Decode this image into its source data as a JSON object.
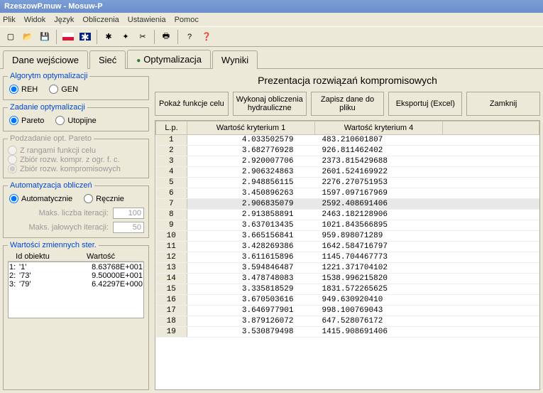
{
  "window": {
    "title": "RzeszowP.muw - Mosuw-P"
  },
  "menu": {
    "items": [
      "Plik",
      "Widok",
      "Język",
      "Obliczenia",
      "Ustawienia",
      "Pomoc"
    ]
  },
  "toolbar_icons": [
    "new",
    "open",
    "save",
    "sep",
    "flag-pl",
    "flag-uk",
    "sep",
    "run-black",
    "printer",
    "run-cut",
    "sep",
    "print",
    "sep",
    "help-q",
    "help-ex"
  ],
  "tabs": {
    "items": [
      "Dane wejściowe",
      "Sieć",
      "Optymalizacja",
      "Wyniki"
    ],
    "active": 2
  },
  "left": {
    "algo": {
      "legend": "Algorytm optymalizacji",
      "opts": [
        "REH",
        "GEN"
      ],
      "sel": 0
    },
    "task": {
      "legend": "Zadanie optymalizacji",
      "opts": [
        "Pareto",
        "Utopijne"
      ],
      "sel": 0
    },
    "subpareto": {
      "legend": "Podzadanie opt. Pareto",
      "opts": [
        "Z rangami funkcji celu",
        "Zbiór rozw. kompr. z ogr. f. c.",
        "Zbiór rozw. kompromisowych"
      ],
      "sel": 2
    },
    "auto": {
      "legend": "Automatyzacja obliczeń",
      "opts": [
        "Automatycznie",
        "Ręcznie"
      ],
      "sel": 0,
      "iter_label": "Maks. liczba iteracji:",
      "iter_val": "100",
      "idle_label": "Maks. jałowych iteracji:",
      "idle_val": "50"
    },
    "ster": {
      "legend": "Wartości zmiennych ster.",
      "cols": [
        "Id obiektu",
        "Wartość"
      ],
      "rows": [
        {
          "n": "1:",
          "id": "'1'",
          "v": "8.63768E+001"
        },
        {
          "n": "2:",
          "id": "'73'",
          "v": "9.50000E+001"
        },
        {
          "n": "3:",
          "id": "'79'",
          "v": "6.42297E+000"
        }
      ]
    }
  },
  "right": {
    "title": "Prezentacja rozwiązań kompromisowych",
    "buttons": [
      "Pokaż funkcje celu",
      "Wykonaj obliczenia hydrauliczne",
      "Zapisz dane do pliku",
      "Eksportuj (Excel)",
      "Zamknij"
    ],
    "cols": [
      "L.p.",
      "Wartość kryterium 1",
      "Wartość kryterium 4"
    ],
    "sel_row": 7,
    "rows": [
      {
        "lp": 1,
        "a": "4.033502579",
        "b": "483.210601807"
      },
      {
        "lp": 2,
        "a": "3.682776928",
        "b": "926.811462402"
      },
      {
        "lp": 3,
        "a": "2.920007706",
        "b": "2373.815429688"
      },
      {
        "lp": 4,
        "a": "2.906324863",
        "b": "2601.524169922"
      },
      {
        "lp": 5,
        "a": "2.948856115",
        "b": "2276.270751953"
      },
      {
        "lp": 6,
        "a": "3.450896263",
        "b": "1597.097167969"
      },
      {
        "lp": 7,
        "a": "2.906835079",
        "b": "2592.408691406"
      },
      {
        "lp": 8,
        "a": "2.913858891",
        "b": "2463.182128906"
      },
      {
        "lp": 9,
        "a": "3.637013435",
        "b": "1021.843566895"
      },
      {
        "lp": 10,
        "a": "3.665156841",
        "b": "959.898071289"
      },
      {
        "lp": 11,
        "a": "3.428269386",
        "b": "1642.584716797"
      },
      {
        "lp": 12,
        "a": "3.611615896",
        "b": "1145.704467773"
      },
      {
        "lp": 13,
        "a": "3.594846487",
        "b": "1221.371704102"
      },
      {
        "lp": 14,
        "a": "3.478748083",
        "b": "1538.996215820"
      },
      {
        "lp": 15,
        "a": "3.335818529",
        "b": "1831.572265625"
      },
      {
        "lp": 16,
        "a": "3.670503616",
        "b": "949.630920410"
      },
      {
        "lp": 17,
        "a": "3.646977901",
        "b": "998.100769043"
      },
      {
        "lp": 18,
        "a": "3.879126072",
        "b": "647.528076172"
      },
      {
        "lp": 19,
        "a": "3.530879498",
        "b": "1415.908691406"
      }
    ]
  }
}
